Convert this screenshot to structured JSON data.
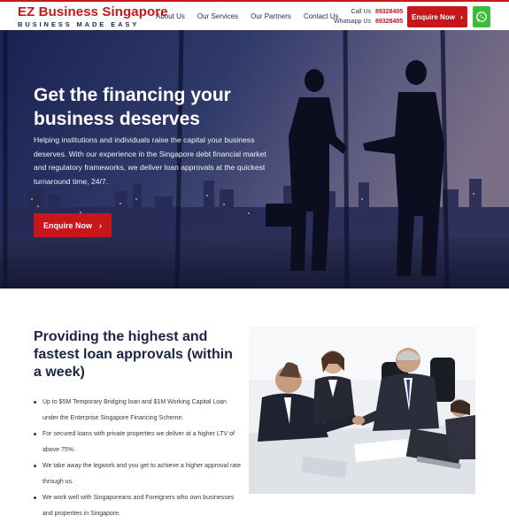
{
  "header": {
    "logo_title": "EZ Business Singapore",
    "logo_tagline": "BUSINESS MADE EASY",
    "nav": [
      {
        "label": "About Us"
      },
      {
        "label": "Our Services"
      },
      {
        "label": "Our Partners"
      },
      {
        "label": "Contact Us"
      }
    ],
    "call_label": "Call Us",
    "call_number": "89328405",
    "whatsapp_label": "Whatsapp Us",
    "whatsapp_number": "89328405",
    "enquire_label": "Enquire Now",
    "whatsapp_icon": "whatsapp-icon"
  },
  "hero": {
    "title": "Get the financing your business deserves",
    "subtitle": "Helping institutions and individuals raise the capital your business deserves. With our experience in the Singapore debt financial market and regulatory frameworks, we deliver loan approvals at the quickest turnaround time, 24/7.",
    "cta_label": "Enquire Now"
  },
  "section": {
    "title": "Providing the highest and fastest loan approvals (within a week)",
    "bullets": [
      "Up to $5M Temporary Bridging loan and $1M Working Capital Loan under the Enterprise Singapore Financing Scheme.",
      "For secured loans with private properties we deliver at a higher LTV of above 75%.",
      "We take away the legwork and you get to achieve a higher approval rate through us.",
      "We work well with Singaporeans and Foreigners who own businesses and properties in Singapore."
    ]
  },
  "colors": {
    "brand_red": "#c8161d",
    "navy": "#1c2447",
    "whatsapp_green": "#3dbb3a"
  }
}
